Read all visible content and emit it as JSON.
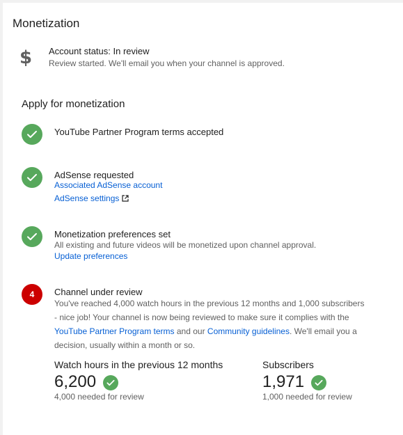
{
  "page": {
    "title": "Monetization"
  },
  "account": {
    "icon": "dollar-icon",
    "status": "Account status: In review",
    "subtitle": "Review started. We'll email you when your channel is approved."
  },
  "apply": {
    "heading": "Apply for monetization",
    "steps": [
      {
        "state": "done",
        "title": "YouTube Partner Program terms accepted"
      },
      {
        "state": "done",
        "title": "AdSense requested",
        "links": [
          "Associated AdSense account",
          "AdSense settings"
        ]
      },
      {
        "state": "done",
        "title": "Monetization preferences set",
        "subtitle": "All existing and future videos will be monetized upon channel approval.",
        "links": [
          "Update preferences"
        ]
      },
      {
        "state": "current",
        "number": "4",
        "title": "Channel under review",
        "text_part1": "You've reached 4,000 watch hours in the previous 12 months and 1,000 subscribers - nice job! Your channel is now being reviewed to make sure it complies with the ",
        "link1": "YouTube Partner Program terms",
        "text_part2": " and our ",
        "link2": "Community guidelines",
        "text_part3": ". We'll email you a decision, usually within a month or so."
      }
    ]
  },
  "metrics": {
    "watch_hours": {
      "label": "Watch hours in the previous 12 months",
      "value": "6,200",
      "needed": "4,000 needed for review"
    },
    "subscribers": {
      "label": "Subscribers",
      "value": "1,971",
      "needed": "1,000 needed for review"
    }
  },
  "colors": {
    "success": "#57a85c",
    "alert": "#cc0000",
    "link": "#065fd4"
  }
}
